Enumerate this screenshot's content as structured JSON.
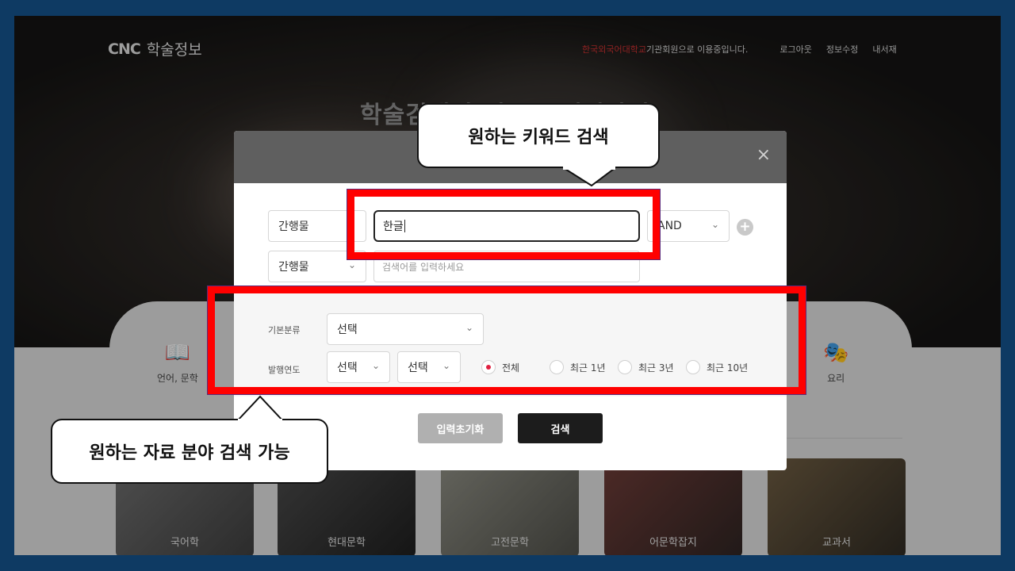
{
  "header": {
    "logo_brand": "CNC",
    "logo_name": "학술정보",
    "institution": "한국외국어대학교",
    "member_text": "기관회원으로 이용중입니다.",
    "logout": "로그아웃",
    "edit_info": "정보수정",
    "my_library": "내서재"
  },
  "hero": {
    "title": "학술검색의 새로운 패러다임"
  },
  "modal": {
    "close_symbol": "×",
    "rows": [
      {
        "field": "간행물",
        "keyword": "한글",
        "operator": "AND"
      },
      {
        "field": "간행물",
        "placeholder": "검색어를 입력하세요"
      }
    ],
    "filters": {
      "category_label": "기본분류",
      "category_value": "선택",
      "year_label": "발행연도",
      "year_from": "선택",
      "year_to": "선택",
      "periods": [
        "전체",
        "최근 1년",
        "최근 3년",
        "최근 10년"
      ],
      "selected_period": "전체"
    },
    "reset_label": "입력초기화",
    "search_label": "검색"
  },
  "categories": {
    "left_label": "언어, 문학",
    "right_label": "요리"
  },
  "cards": [
    "국어학",
    "현대문학",
    "고전문학",
    "어문학잡지",
    "교과서"
  ],
  "annotations": {
    "keyword_callout": "원하는 키워드 검색",
    "field_callout": "원하는 자료 분야 검색 가능"
  },
  "colors": {
    "accent_red": "#ff0000",
    "radio_selected": "#e02040",
    "frame_blue": "#0e3a63"
  }
}
